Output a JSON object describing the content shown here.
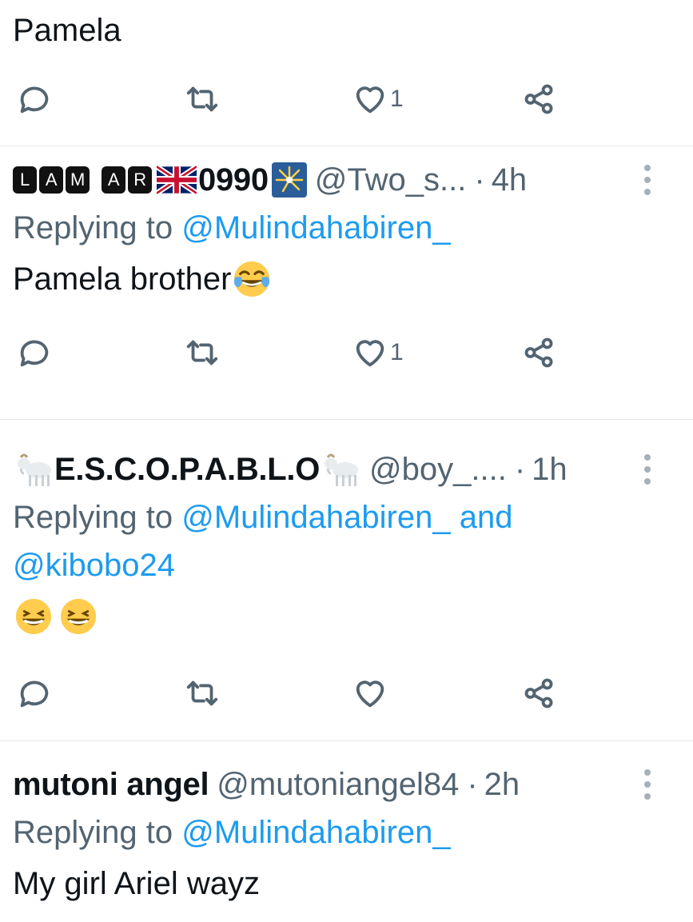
{
  "tweets": [
    {
      "text": "Pamela",
      "likes": "1"
    },
    {
      "name_boxed_1": [
        "L",
        "A",
        "M"
      ],
      "name_boxed_2": [
        "A",
        "R"
      ],
      "name_suffix": "0990",
      "handle": "@Two_s...",
      "dot": "·",
      "time": "4h",
      "replying_prefix": "Replying to ",
      "mention_1": "@Mulindahabiren_",
      "text": "Pamela brother",
      "likes": "1"
    },
    {
      "name": "E.S.C.O.P.A.B.L.O",
      "handle": "@boy_....",
      "dot": "·",
      "time": "1h",
      "replying_prefix": "Replying to ",
      "mention_1": "@Mulindahabiren_",
      "and": " and",
      "mention_2": "@kibobo24"
    },
    {
      "name": "mutoni angel",
      "handle": "@mutoniangel84",
      "dot": "·",
      "time": "2h",
      "replying_prefix": "Replying to ",
      "mention_1": "@Mulindahabiren_",
      "text": "My girl Ariel wayz"
    }
  ],
  "icons": {
    "reply": "reply-icon",
    "retweet": "retweet-icon",
    "like": "heart-icon",
    "share": "share-icon",
    "more": "more-vertical-icon"
  },
  "colors": {
    "text": "#0f1419",
    "muted": "#536471",
    "link": "#1d9bf0",
    "divider": "#e1e6ea"
  }
}
